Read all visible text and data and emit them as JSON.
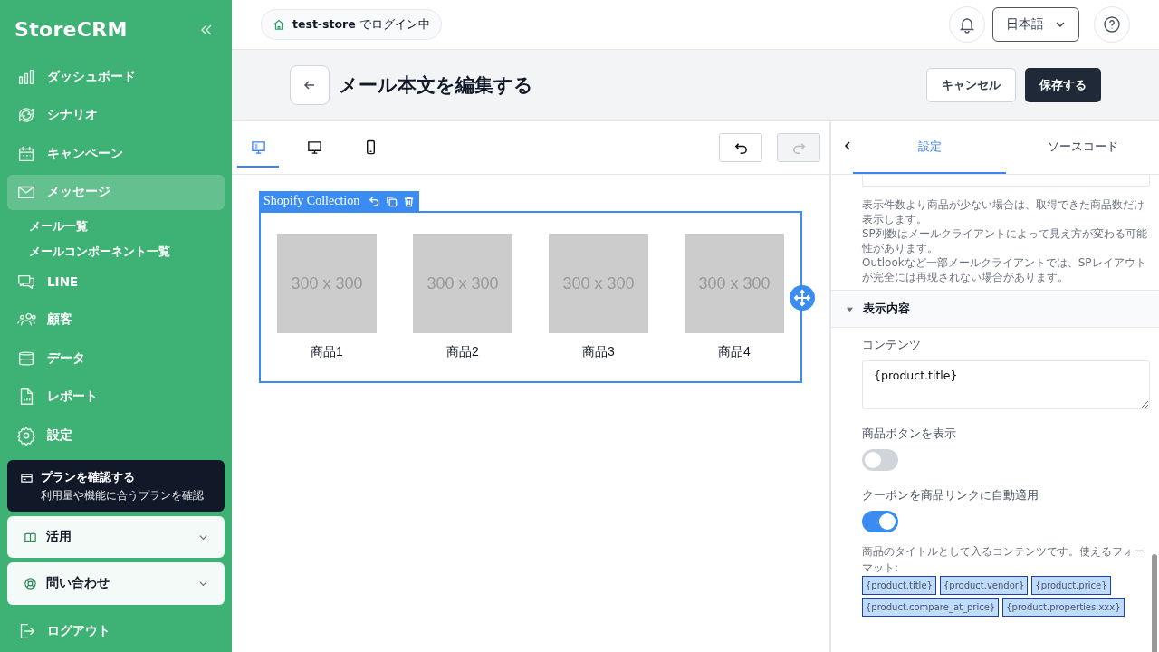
{
  "sidebar": {
    "logo": "StoreCRM",
    "items": [
      {
        "label": "ダッシュボード",
        "selected": false
      },
      {
        "label": "シナリオ",
        "selected": false
      },
      {
        "label": "キャンペーン",
        "selected": false
      },
      {
        "label": "メッセージ",
        "selected": true,
        "children": [
          {
            "label": "メール一覧"
          },
          {
            "label": "メールコンポーネント一覧"
          }
        ]
      },
      {
        "label": "LINE",
        "selected": false
      },
      {
        "label": "顧客",
        "selected": false
      },
      {
        "label": "データ",
        "selected": false
      },
      {
        "label": "レポート",
        "selected": false
      },
      {
        "label": "設定",
        "selected": false
      }
    ],
    "plan": {
      "title": "プランを確認する",
      "subtitle": "利用量や機能に合うプランを確認"
    },
    "sections": [
      {
        "label": "活用",
        "expanded": false
      },
      {
        "label": "問い合わせ",
        "expanded": false
      }
    ],
    "logout": "ログアウト"
  },
  "header": {
    "store": "test-store",
    "login_text": "でログイン中",
    "language": "日本語"
  },
  "page": {
    "title": "メール本文を編集する",
    "cancel": "キャンセル",
    "save": "保存する"
  },
  "editor": {
    "devices": [
      {
        "kind": "both",
        "selected": true
      },
      {
        "kind": "desktop",
        "selected": false
      },
      {
        "kind": "mobile",
        "selected": false
      }
    ],
    "undo_disabled": false,
    "redo_disabled": true,
    "block": {
      "label": "Shopify Collection",
      "products": [
        {
          "image": "300 x 300",
          "name": "商品1"
        },
        {
          "image": "300 x 300",
          "name": "商品2"
        },
        {
          "image": "300 x 300",
          "name": "商品3"
        },
        {
          "image": "300 x 300",
          "name": "商品4"
        }
      ]
    }
  },
  "panel": {
    "tabs": [
      {
        "label": "設定",
        "selected": true
      },
      {
        "label": "ソースコード",
        "selected": false
      }
    ],
    "notes": [
      "表示件数より商品が少ない場合は、取得できた商品数だけ表示します。",
      "SP列数はメールクライアントによって見え方が変わる可能性があります。",
      "Outlookなど一部メールクライアントでは、SPレイアウトが完全には再現されない場合があります。"
    ],
    "section": {
      "title": "表示内容",
      "expanded": true
    },
    "content_label": "コンテンツ",
    "content_value": "{product.title}",
    "toggles": [
      {
        "label": "商品ボタンを表示",
        "on": false
      },
      {
        "label": "クーポンを商品リンクに自動適用",
        "on": true
      }
    ],
    "help": "商品のタイトルとして入るコンテンツです。使えるフォーマット:",
    "formats": [
      "{product.title}",
      "{product.vendor}",
      "{product.price}",
      "{product.compare_at_price}",
      "{product.properties.xxx}"
    ]
  }
}
